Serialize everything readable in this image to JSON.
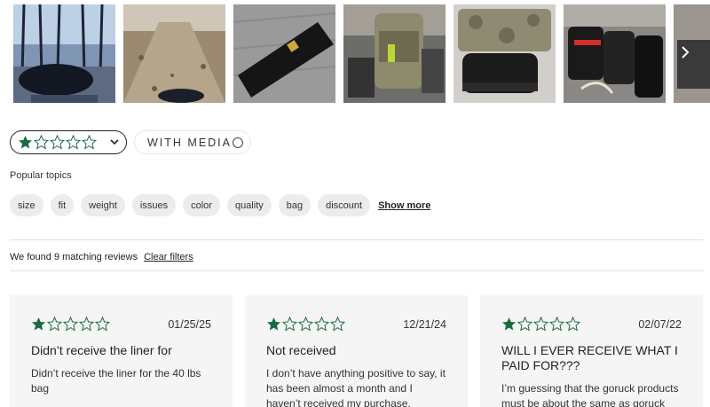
{
  "gallery": {
    "images": [
      {
        "name": "photo-1",
        "alt": "Black duffel bag in a forest"
      },
      {
        "name": "photo-2",
        "alt": "Trail with gravel and bag"
      },
      {
        "name": "photo-3",
        "alt": "Black sandbag on floor"
      },
      {
        "name": "photo-4",
        "alt": "Camo backpack with gear"
      },
      {
        "name": "photo-5",
        "alt": "Camo sandbag and black filler"
      },
      {
        "name": "photo-6",
        "alt": "Assorted red and black gear"
      },
      {
        "name": "photo-7",
        "alt": "Bag partially visible"
      }
    ],
    "next_icon": "chevron-right-icon"
  },
  "filters": {
    "rating_selected": 1,
    "rating_max": 5,
    "star_color": "#1a6b3f",
    "media_label": "WITH MEDIA"
  },
  "topics": {
    "label": "Popular topics",
    "items": [
      "size",
      "fit",
      "weight",
      "issues",
      "color",
      "quality",
      "bag",
      "discount"
    ],
    "show_more": "Show more"
  },
  "results": {
    "summary": "We found 9 matching reviews",
    "clear": "Clear filters"
  },
  "reviews": [
    {
      "rating": 1,
      "date": "01/25/25",
      "title": "Didn’t receive the liner for",
      "body": "Didn’t receive the liner for the 40 lbs bag"
    },
    {
      "rating": 1,
      "date": "12/21/24",
      "title": "Not received",
      "body": "I don’t have anything positive to say, it has been almost a month and I haven’t received my purchase."
    },
    {
      "rating": 1,
      "date": "02/07/22",
      "title": "WILL I EVER RECEIVE WHAT I PAID FOR???",
      "body": "I’m guessing that the goruck products must be about the same as goruck"
    }
  ]
}
